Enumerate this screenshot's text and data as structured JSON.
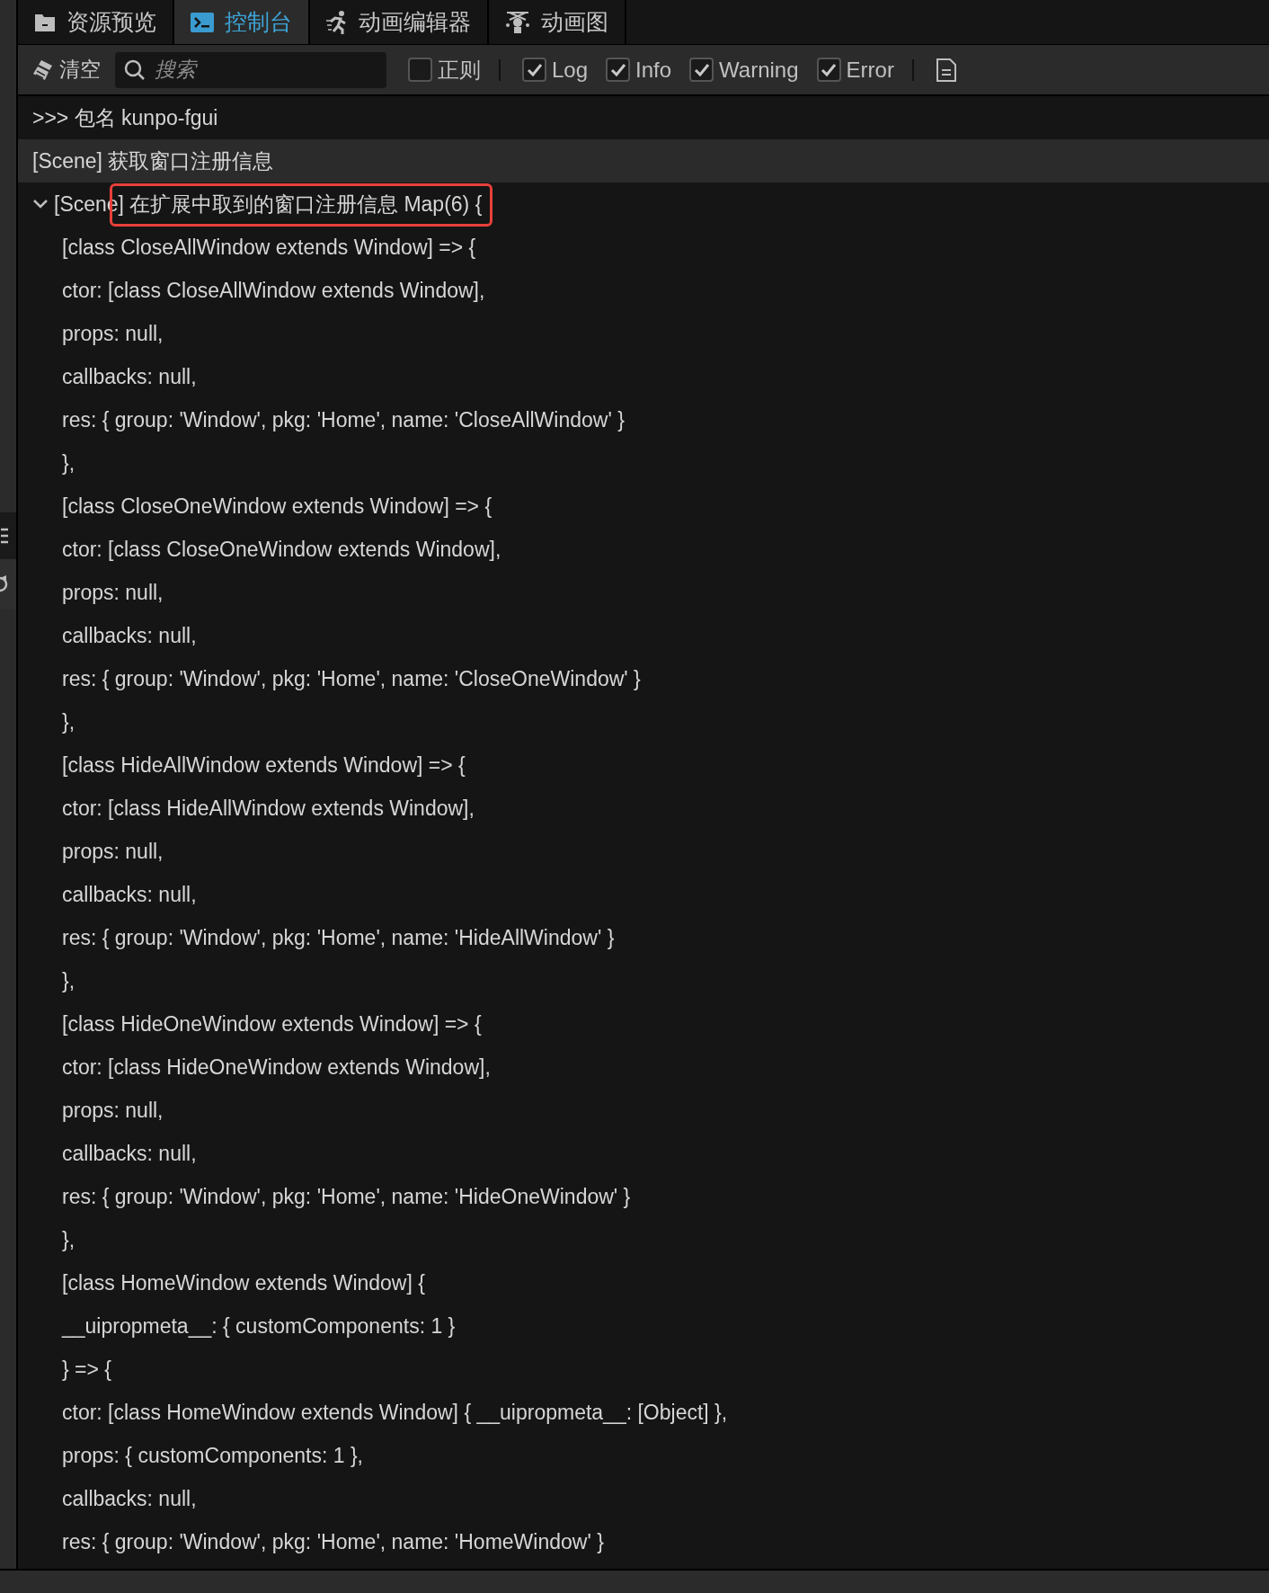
{
  "tabs": [
    {
      "label": "资源预览",
      "selected": false
    },
    {
      "label": "控制台",
      "selected": true
    },
    {
      "label": "动画编辑器",
      "selected": false
    },
    {
      "label": "动画图",
      "selected": false
    }
  ],
  "toolbar": {
    "clear_button": "清空",
    "search": {
      "placeholder": "搜索"
    },
    "filters": [
      {
        "label": "正则",
        "checked": false
      },
      {
        "label": "Log",
        "checked": true
      },
      {
        "label": "Info",
        "checked": true
      },
      {
        "label": "Warning",
        "checked": true
      },
      {
        "label": "Error",
        "checked": true
      }
    ]
  },
  "entries": [
    {
      "kind": "plain",
      "text": ">>> 包名 kunpo-fgui",
      "highlighted": false
    },
    {
      "kind": "plain",
      "text": "[Scene] 获取窗口注册信息",
      "highlighted": true
    },
    {
      "kind": "group",
      "label": "[Scene]",
      "message": "在扩展中取到的窗口注册信息 Map(6) {",
      "expanded": true,
      "annotated": true,
      "highlighted": false,
      "lines": [
        "[class CloseAllWindow extends Window] => {",
        "ctor: [class CloseAllWindow extends Window],",
        "props: null,",
        "callbacks: null,",
        "res: { group: 'Window', pkg: 'Home', name: 'CloseAllWindow' }",
        "},",
        "[class CloseOneWindow extends Window] => {",
        "ctor: [class CloseOneWindow extends Window],",
        "props: null,",
        "callbacks: null,",
        "res: { group: 'Window', pkg: 'Home', name: 'CloseOneWindow' }",
        "},",
        "[class HideAllWindow extends Window] => {",
        "ctor: [class HideAllWindow extends Window],",
        "props: null,",
        "callbacks: null,",
        "res: { group: 'Window', pkg: 'Home', name: 'HideAllWindow' }",
        "},",
        "[class HideOneWindow extends Window] => {",
        "ctor: [class HideOneWindow extends Window],",
        "props: null,",
        "callbacks: null,",
        "res: { group: 'Window', pkg: 'Home', name: 'HideOneWindow' }",
        "},",
        "[class HomeWindow extends Window] {",
        "__uipropmeta__: { customComponents: 1 }",
        "} => {",
        "ctor: [class HomeWindow extends Window] { __uipropmeta__: [Object] },",
        "props: { customComponents: 1 },",
        "callbacks: null,",
        "res: { group: 'Window', pkg: 'Home', name: 'HomeWindow' }"
      ]
    }
  ]
}
